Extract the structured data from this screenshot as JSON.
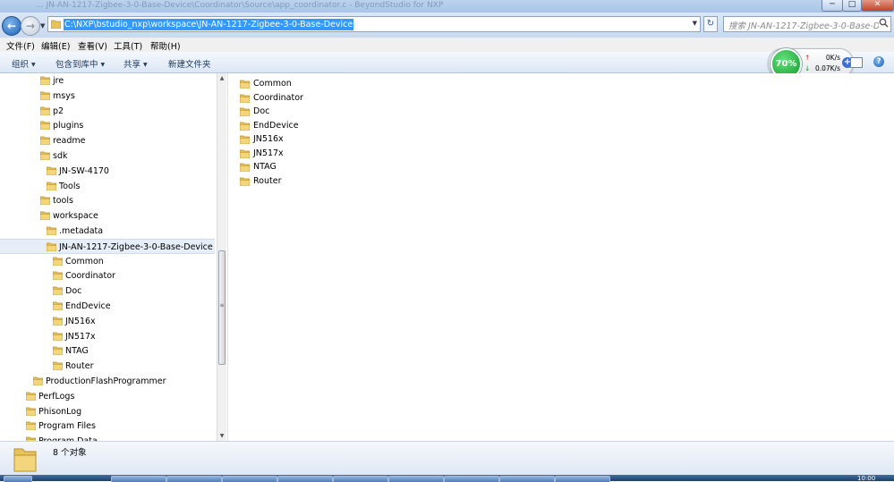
{
  "window": {
    "title": "... JN-AN-1217-Zigbee-3-0-Base-Device\\Coordinator\\Source\\app_coordinator.c - BeyondStudio for NXP",
    "minimize": "─",
    "maximize": "□",
    "close": "✕"
  },
  "address": {
    "path": "C:\\NXP\\bstudio_nxp\\workspace\\JN-AN-1217-Zigbee-3-0-Base-Device",
    "search_placeholder": "搜索 JN-AN-1217-Zigbee-3-0-Base-D..."
  },
  "menu": [
    "文件(F)",
    "编辑(E)",
    "查看(V)",
    "工具(T)",
    "帮助(H)"
  ],
  "toolbar": {
    "organize": "组织",
    "include_library": "包含到库中",
    "share": "共享",
    "new_folder": "新建文件夹"
  },
  "network": {
    "percent": "70%",
    "up_speed": "0K/s",
    "down_speed": "0.07K/s",
    "up_arrow": "↑",
    "down_arrow": "↓"
  },
  "nav_tree": [
    {
      "label": "jre",
      "indent": 1
    },
    {
      "label": "msys",
      "indent": 1
    },
    {
      "label": "p2",
      "indent": 1
    },
    {
      "label": "plugins",
      "indent": 1
    },
    {
      "label": "readme",
      "indent": 1
    },
    {
      "label": "sdk",
      "indent": 1
    },
    {
      "label": "JN-SW-4170",
      "indent": 2
    },
    {
      "label": "Tools",
      "indent": 2
    },
    {
      "label": "tools",
      "indent": 1
    },
    {
      "label": "workspace",
      "indent": 1
    },
    {
      "label": ".metadata",
      "indent": 2
    },
    {
      "label": "JN-AN-1217-Zigbee-3-0-Base-Device",
      "indent": 2,
      "selected": true
    },
    {
      "label": "Common",
      "indent": 3
    },
    {
      "label": "Coordinator",
      "indent": 3
    },
    {
      "label": "Doc",
      "indent": 3
    },
    {
      "label": "EndDevice",
      "indent": 3
    },
    {
      "label": "JN516x",
      "indent": 3
    },
    {
      "label": "JN517x",
      "indent": 3
    },
    {
      "label": "NTAG",
      "indent": 3
    },
    {
      "label": "Router",
      "indent": 3
    },
    {
      "label": "ProductionFlashProgrammer",
      "indent": 0
    },
    {
      "label": "PerfLogs",
      "indent": -1
    },
    {
      "label": "PhisonLog",
      "indent": -1
    },
    {
      "label": "Program Files",
      "indent": -1
    },
    {
      "label": "Program Data",
      "indent": -1
    }
  ],
  "files": [
    "Common",
    "Coordinator",
    "Doc",
    "EndDevice",
    "JN516x",
    "JN517x",
    "NTAG",
    "Router"
  ],
  "status": {
    "count_text": "8 个对象"
  },
  "taskbar": {
    "clock": "10:00"
  },
  "colors": {
    "selection": "#3399ff",
    "folder": "#e8c25a",
    "accent": "#1d5fb3"
  }
}
